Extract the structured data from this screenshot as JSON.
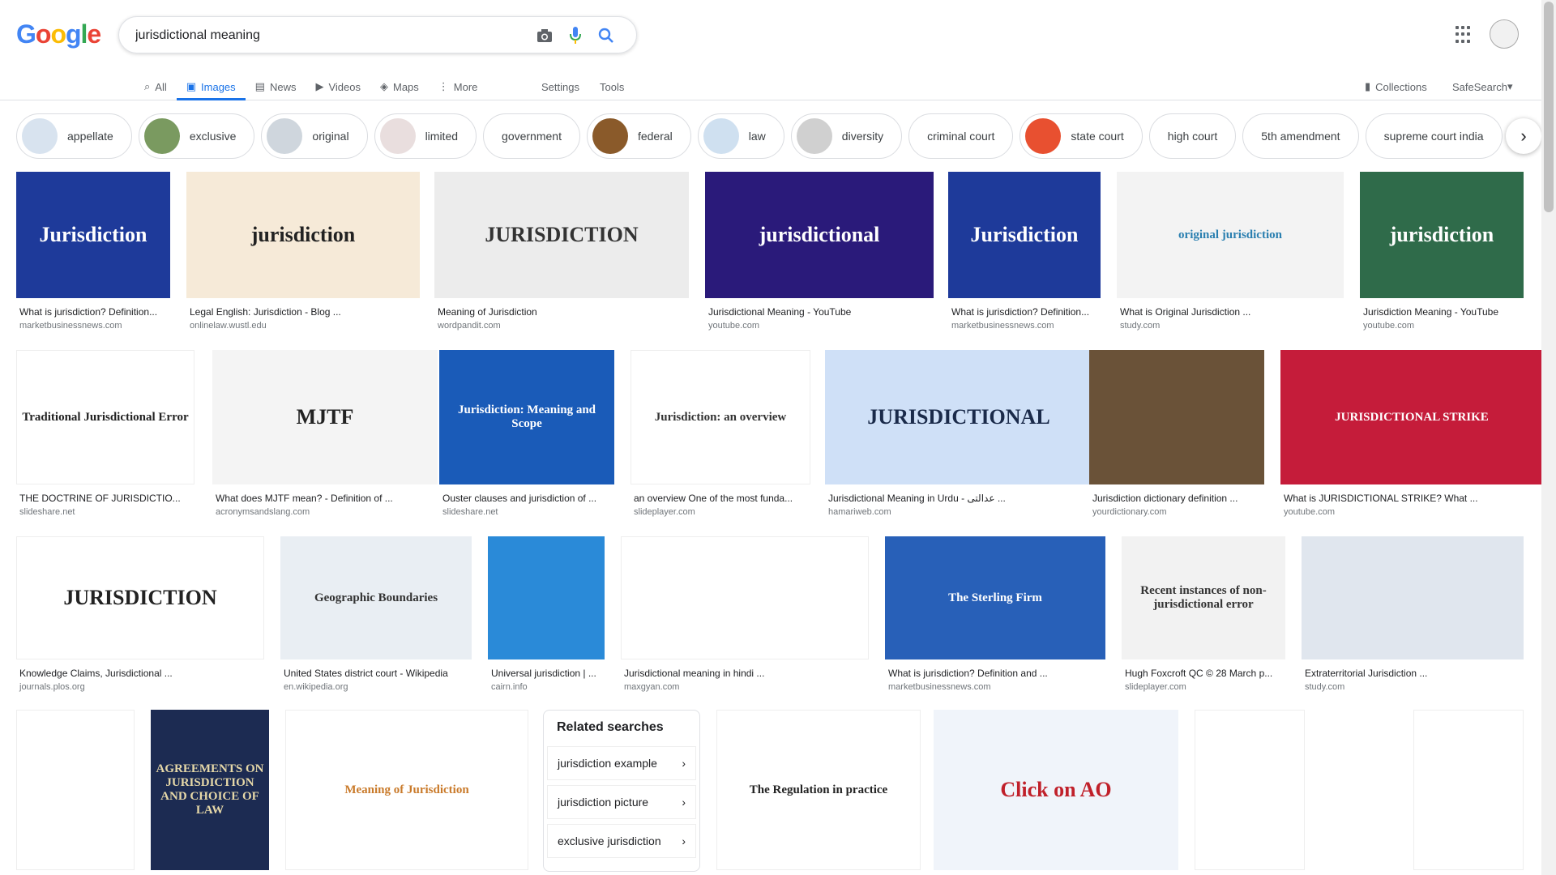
{
  "logo": {
    "letters": [
      "G",
      "o",
      "o",
      "g",
      "l",
      "e"
    ]
  },
  "search": {
    "query": "jurisdictional meaning"
  },
  "nav": {
    "tabs": [
      {
        "label": "All",
        "icon": "search-icon"
      },
      {
        "label": "Images",
        "icon": "image-icon"
      },
      {
        "label": "News",
        "icon": "news-icon"
      },
      {
        "label": "Videos",
        "icon": "video-icon"
      },
      {
        "label": "Maps",
        "icon": "map-icon"
      },
      {
        "label": "More",
        "icon": "more-vert-icon"
      }
    ],
    "settings": "Settings",
    "tools": "Tools",
    "collections": "Collections",
    "safesearch": "SafeSearch"
  },
  "chips": [
    {
      "label": "appellate",
      "color": "#d8e3ef"
    },
    {
      "label": "exclusive",
      "color": "#7a9a60"
    },
    {
      "label": "original",
      "color": "#cfd6dd"
    },
    {
      "label": "limited",
      "color": "#e9dede"
    },
    {
      "label": "government",
      "color": ""
    },
    {
      "label": "federal",
      "color": "#8a5a2a"
    },
    {
      "label": "law",
      "color": "#cfe0f0"
    },
    {
      "label": "diversity",
      "color": "#d0d0d0"
    },
    {
      "label": "criminal court",
      "color": ""
    },
    {
      "label": "state court",
      "color": "#e85030"
    },
    {
      "label": "high court",
      "color": ""
    },
    {
      "label": "5th amendment",
      "color": ""
    },
    {
      "label": "supreme court india",
      "color": ""
    }
  ],
  "rows": [
    [
      {
        "caption": "What is jurisdiction? Definition...",
        "source": "marketbusinessnews.com",
        "text": "Jurisdiction",
        "bg": "#1e3a9a",
        "fg": "#ffffff"
      },
      {
        "caption": "Legal English: Jurisdiction - Blog ...",
        "source": "onlinelaw.wustl.edu",
        "text": "jurisdiction",
        "bg": "#f6ead8",
        "fg": "#222222"
      },
      {
        "caption": "Meaning of Jurisdiction",
        "source": "wordpandit.com",
        "text": "JURISDICTION",
        "bg": "#ececec",
        "fg": "#333333"
      },
      {
        "caption": "Jurisdictional Meaning - YouTube",
        "source": "youtube.com",
        "text": "jurisdictional",
        "bg": "#2a1a7a",
        "fg": "#ffffff"
      },
      {
        "caption": "What is jurisdiction? Definition...",
        "source": "marketbusinessnews.com",
        "text": "Jurisdiction",
        "bg": "#1e3a9a",
        "fg": "#ffffff"
      },
      {
        "caption": "What is Original Jurisdiction ...",
        "source": "study.com",
        "text": "original jurisdiction",
        "bg": "#f3f3f3",
        "fg": "#2a7fb0"
      },
      {
        "caption": "Jurisdiction Meaning - YouTube",
        "source": "youtube.com",
        "text": "jurisdiction",
        "bg": "#2f6b4a",
        "fg": "#ffffff"
      }
    ],
    [
      {
        "caption": "THE DOCTRINE OF JURISDICTIO...",
        "source": "slideshare.net",
        "text": "Traditional Jurisdictional Error",
        "bg": "#ffffff",
        "fg": "#222222"
      },
      {
        "caption": "What does MJTF mean? - Definition of ...",
        "source": "acronymsandslang.com",
        "text": "MJTF",
        "bg": "#f4f4f4",
        "fg": "#222222"
      },
      {
        "caption": "Ouster clauses and jurisdiction of ...",
        "source": "slideshare.net",
        "text": "Jurisdiction: Meaning and Scope",
        "bg": "#1a5bb8",
        "fg": "#ffffff"
      },
      {
        "caption": "an overview One of the most funda...",
        "source": "slideplayer.com",
        "text": "Jurisdiction: an overview",
        "bg": "#ffffff",
        "fg": "#333333"
      },
      {
        "caption": "Jurisdictional Meaning in Urdu - عدالتی ...",
        "source": "hamariweb.com",
        "text": "JURISDICTIONAL",
        "bg": "#cfe0f7",
        "fg": "#1a2a4a"
      },
      {
        "caption": "Jurisdiction dictionary definition ...",
        "source": "yourdictionary.com",
        "text": "",
        "bg": "#6a5238",
        "fg": "#ffffff"
      },
      {
        "caption": "What is JURISDICTIONAL STRIKE? What ...",
        "source": "youtube.com",
        "text": "JURISDICTIONAL STRIKE",
        "bg": "#c51c3a",
        "fg": "#ffffff"
      }
    ],
    [
      {
        "caption": "Knowledge Claims, Jurisdictional ...",
        "source": "journals.plos.org",
        "text": "JURISDICTION",
        "bg": "#ffffff",
        "fg": "#222222"
      },
      {
        "caption": "United States district court - Wikipedia",
        "source": "en.wikipedia.org",
        "text": "Geographic Boundaries",
        "bg": "#e9eef3",
        "fg": "#333333"
      },
      {
        "caption": "Universal jurisdiction | ...",
        "source": "cairn.info",
        "text": "",
        "bg": "#2a8ad8",
        "fg": "#ffffff"
      },
      {
        "caption": "Jurisdictional meaning in hindi ...",
        "source": "maxgyan.com",
        "text": "",
        "bg": "#ffffff",
        "fg": "#333333"
      },
      {
        "caption": "What is jurisdiction? Definition and ...",
        "source": "marketbusinessnews.com",
        "text": "The Sterling Firm",
        "bg": "#2860b8",
        "fg": "#ffffff"
      },
      {
        "caption": "Hugh Foxcroft QC © 28 March p...",
        "source": "slideplayer.com",
        "text": "Recent instances of non-jurisdictional error",
        "bg": "#f2f2f2",
        "fg": "#333333"
      },
      {
        "caption": "Extraterritorial Jurisdiction ...",
        "source": "study.com",
        "text": "",
        "bg": "#e0e6ee",
        "fg": "#333333"
      }
    ],
    [
      {
        "caption": "",
        "source": "",
        "text": "",
        "bg": "#ffffff",
        "fg": "#333333"
      },
      {
        "caption": "",
        "source": "",
        "text": "AGREEMENTS ON JURISDICTION AND CHOICE OF LAW",
        "bg": "#1c2b52",
        "fg": "#e6d8a8"
      },
      {
        "caption": "",
        "source": "",
        "text": "Meaning of Jurisdiction",
        "bg": "#ffffff",
        "fg": "#c97a2a"
      },
      {
        "caption": "",
        "source": "",
        "text": "The Regulation in practice",
        "bg": "#ffffff",
        "fg": "#222222"
      },
      {
        "caption": "",
        "source": "",
        "text": "Click on AO",
        "bg": "#f0f4fa",
        "fg": "#c0202a"
      },
      {
        "caption": "",
        "source": "",
        "text": "",
        "bg": "#ffffff",
        "fg": "#333333"
      },
      {
        "caption": "",
        "source": "",
        "text": "",
        "bg": "#ffffff",
        "fg": "#333333"
      }
    ]
  ],
  "related": {
    "title": "Related searches",
    "items": [
      "jurisdiction example",
      "jurisdiction picture",
      "exclusive jurisdiction"
    ]
  }
}
